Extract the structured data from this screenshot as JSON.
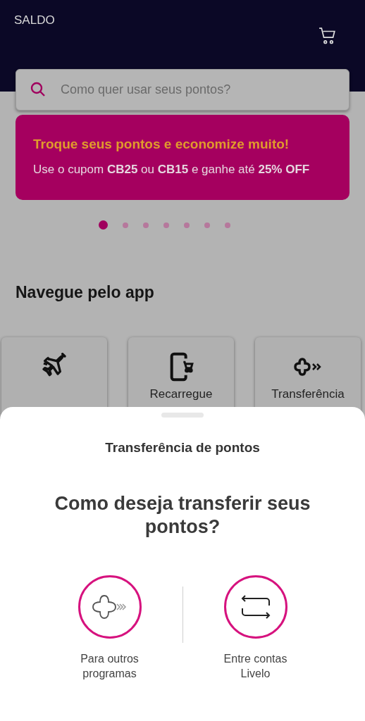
{
  "header": {
    "balance_label": "SALDO"
  },
  "search": {
    "placeholder": "Como quer usar seus pontos?"
  },
  "banner": {
    "title": "Troque seus pontos e economize muito!",
    "text": "Use o cupom **CB25** ou **CB15** e ganhe até **25% OFF**"
  },
  "carousel_dots": [
    {
      "selected": true
    },
    {
      "selected": false
    },
    {
      "selected": false
    },
    {
      "selected": false
    },
    {
      "selected": false
    },
    {
      "selected": false
    },
    {
      "selected": false
    }
  ],
  "section_title": "Navegue pelo app",
  "shortcuts": [
    {
      "kind": "plane"
    },
    {
      "kind": "phone",
      "label": "Recarregue"
    },
    {
      "kind": "transfer",
      "label": "Transferência"
    }
  ],
  "sheet": {
    "title": "Transferência de pontos",
    "question": "Como deseja transferir seus pontos?",
    "options": [
      {
        "kind": "programs",
        "label": "Para outros programas"
      },
      {
        "kind": "accounts",
        "label": "Entre contas Livelo"
      }
    ]
  }
}
